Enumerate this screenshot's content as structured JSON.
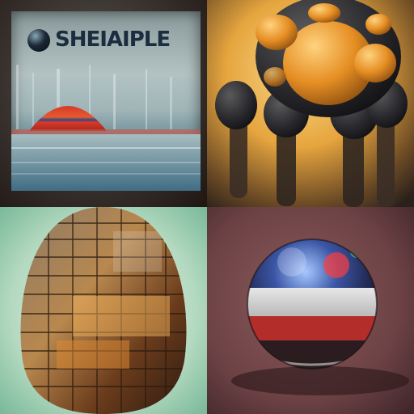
{
  "image": {
    "tiles": [
      {
        "title_text": "SHEIAIPLE"
      },
      {},
      {},
      {}
    ]
  }
}
